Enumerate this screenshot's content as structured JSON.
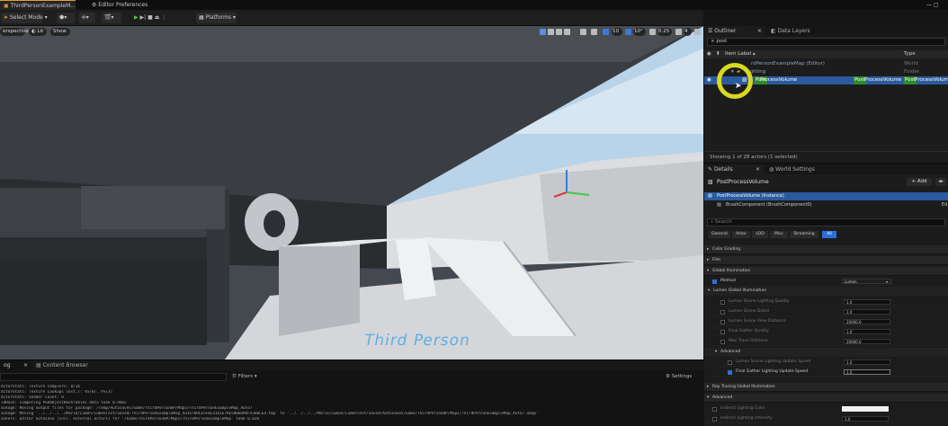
{
  "titlebar": {
    "tabs": [
      "ThirdPersonExampleM...",
      "Editor Preferences"
    ]
  },
  "toolbar": {
    "mode": "Select Mode",
    "platforms": "Platforms"
  },
  "viewport": {
    "perspective": "erspective",
    "lit": "Lit",
    "show": "Show",
    "grid_snap": "10",
    "rot_snap": "10°",
    "scale_snap": "0.25",
    "cam_speed": "4",
    "floor_text": "Third Person"
  },
  "outliner": {
    "tab": "Outliner",
    "tab2": "Data Layers",
    "search": "post",
    "col_label": "Item Label ▴",
    "col_type": "Type",
    "rows": [
      {
        "label": "rdPersonExampleMap (Editor)",
        "type": "World"
      },
      {
        "label": "Lighting",
        "type": "Folder"
      },
      {
        "label": "ProcessVolume",
        "type_hl": "Post",
        "type_rest": "ProcessVolume",
        "type2_hl": "Post",
        "type2_rest": "ProcessVolume"
      }
    ],
    "status": "Showing 1 of 28 actors (1 selected)"
  },
  "details": {
    "tab": "Details",
    "tab2": "World Settings",
    "object": "PostProcessVolume",
    "add": "+ Add",
    "instance": "PostProcessVolume (Instance)",
    "brush": "BrushComponent (BrushComponent0)",
    "brush_tail": "Ed",
    "search": "Search",
    "filters": [
      "General",
      "Actor",
      "LOD",
      "Misc",
      "Streaming",
      "All"
    ],
    "sections": {
      "color_grading": "Color Grading",
      "film": "Film",
      "gi": "Global Illumination",
      "method_label": "Method",
      "method_value": "Lumen",
      "lumen_gi": "Lumen Global Illumination",
      "props": [
        {
          "label": "Lumen Scene Lighting Quality",
          "value": "1.0"
        },
        {
          "label": "Lumen Scene Detail",
          "value": "1.0"
        },
        {
          "label": "Lumen Scene View Distance",
          "value": "20000.0"
        },
        {
          "label": "Final Gather Quality",
          "value": "1.0"
        },
        {
          "label": "Max Trace Distance",
          "value": "20000.0"
        }
      ],
      "advanced": "Advanced",
      "props2": [
        {
          "label": "Lumen Scene Lighting Update Speed",
          "value": "1.0"
        },
        {
          "label": "Final Gather Lighting Update Speed",
          "value": "1.0"
        }
      ],
      "rt_gi": "Ray Tracing Global Illumination",
      "advanced2": "Advanced",
      "indirect_color": "Indirect Lighting Color",
      "indirect_int": "Indirect Lighting Intensity",
      "indirect_int_val": "1.0"
    }
  },
  "bottom": {
    "tab": "Output Log",
    "tab_short": "og",
    "tab2": "Content Browser",
    "filters": "Filters",
    "settings": "Settings",
    "lines": [
      "ditorStats:  Texture samplers: 0/16",
      "ditorStats:  Texture Lookups (Est.): VS(0), PS(3)",
      "ditorStats:  Shader Count: 0",
      "ldHash: Computing PSOObjectHashTables data took    0.94ms",
      "ackage: Moving output files for package: /Temp/Autosaves/Game/ThirdPersonBP/Maps/ThirdPersonExampleMap_Auto7",
      "ackage: Moving '../../../../Marie/Lumen/LumenTest/Saved/ThirdPersonExampleMap_Auto7B9CE5FBC4161E7AE5006D9DF4306CE4.tmp' to '../../../../Marie/Lumen/LumenTest/Saved/Autosaves/Game/ThirdPersonBP/Maps/ThirdPersonExampleMap_Auto7.umap'",
      "ackers: Editor autosave (incl. external actors) for '/Game/ThirdPersonBP/Maps/ThirdPersonExampleMap' took 0.036"
    ]
  }
}
